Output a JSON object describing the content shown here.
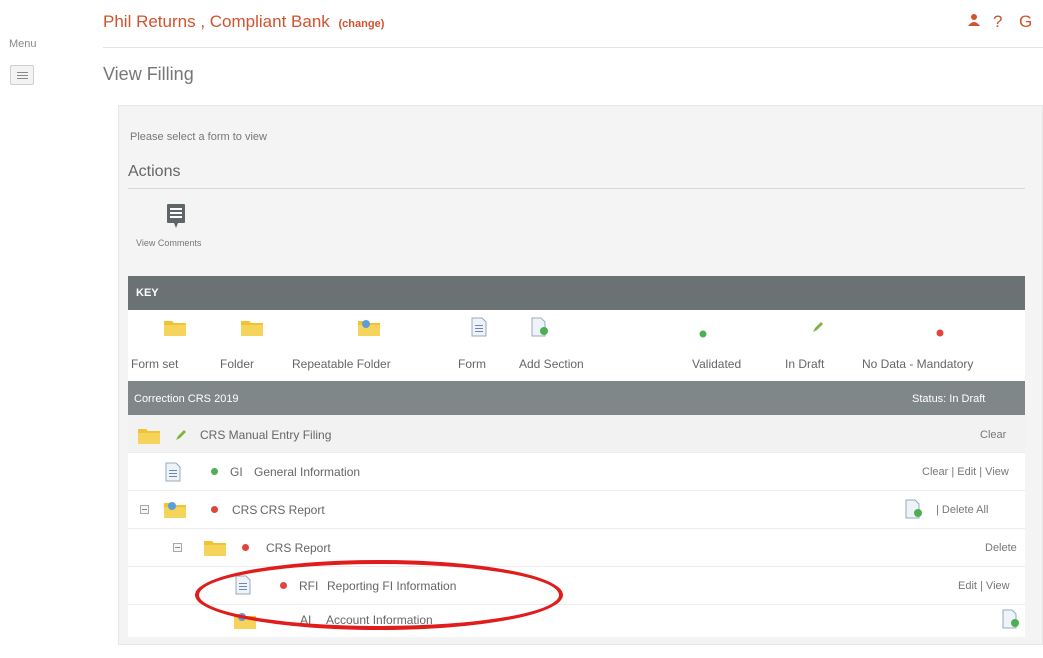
{
  "menu": {
    "label": "Menu"
  },
  "header": {
    "bank": "Phil Returns , Compliant Bank",
    "change": "(change)",
    "page_title": "View Filling",
    "icons": [
      "user-icon",
      "help-icon",
      "g-icon"
    ],
    "accent": "#d2522d"
  },
  "main": {
    "select_text": "Please select a form to view",
    "actions_title": "Actions",
    "view_comments": "View Comments"
  },
  "key": {
    "title": "KEY",
    "items": [
      "Form set",
      "Folder",
      "Repeatable Folder",
      "Form",
      "Add Section",
      "Validated",
      "In Draft",
      "No Data - Mandatory"
    ]
  },
  "filing": {
    "name": "Correction CRS 2019",
    "status": "Status: In Draft"
  },
  "tree": [
    {
      "label": "CRS Manual Entry Filing",
      "actions": "Clear"
    },
    {
      "code": "GI",
      "label": "General Information",
      "actions": "Clear | Edit | View"
    },
    {
      "code": "CRS",
      "label": "CRS Report",
      "actions": "| Delete All"
    },
    {
      "code": "",
      "label": "CRS Report",
      "actions": "Delete"
    },
    {
      "code": "RFI",
      "label": "Reporting FI Information",
      "actions": "Edit | View"
    },
    {
      "code": "AI",
      "label": "Account Information",
      "actions": ""
    }
  ],
  "colors": {
    "key_header": "#6b7273",
    "filing_bar": "#808789",
    "validated": "#4caf50",
    "mandatory": "#e0443a",
    "highlight": "#e11c1c"
  }
}
